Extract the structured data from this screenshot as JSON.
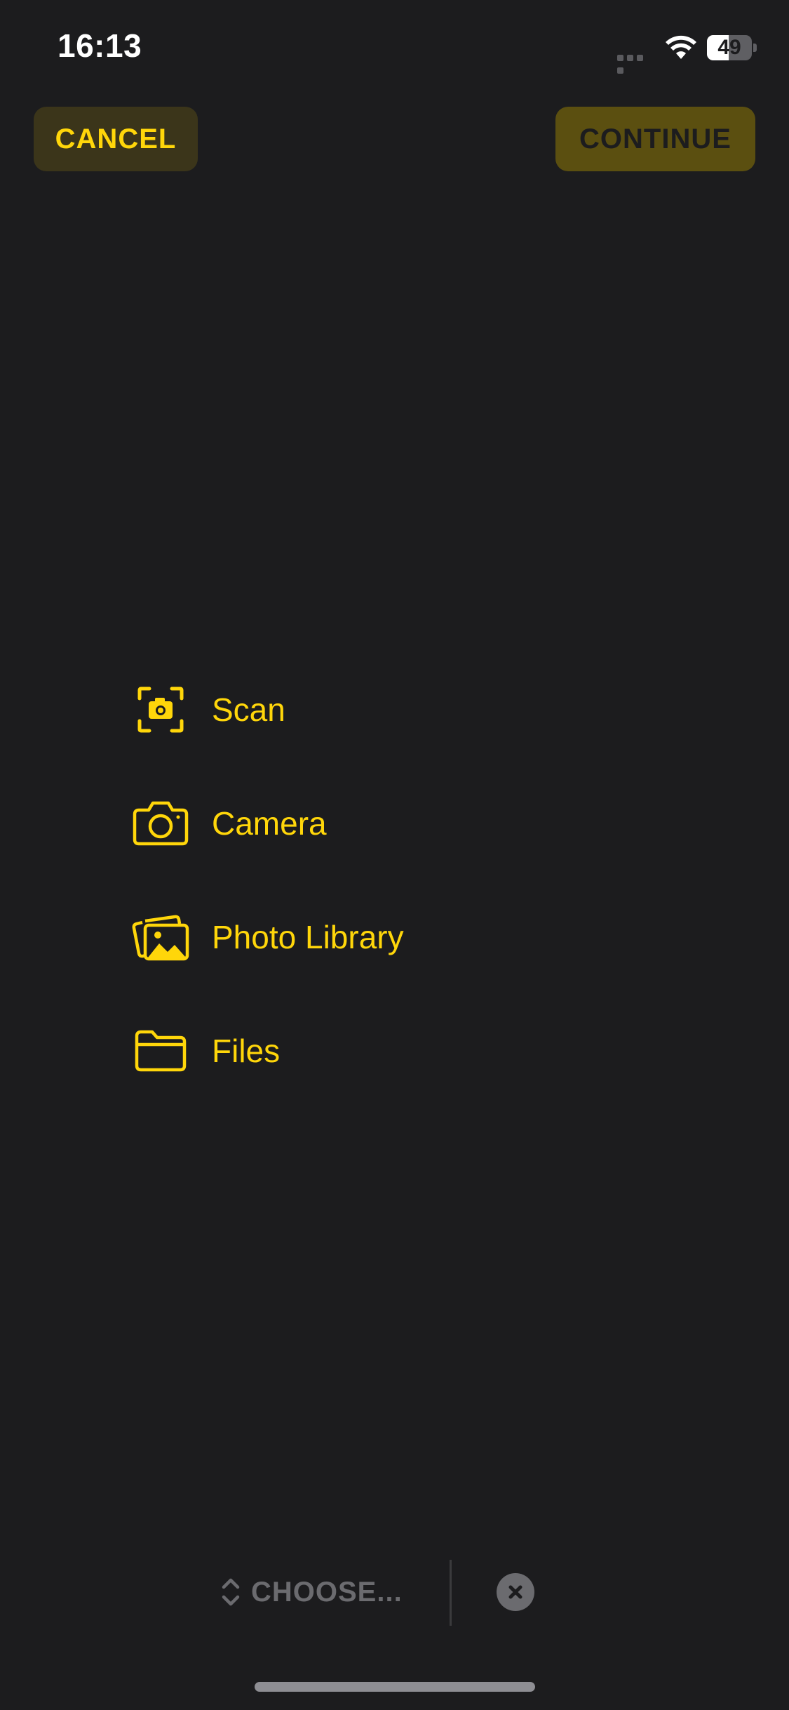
{
  "status_bar": {
    "time": "16:13",
    "battery_level": "49",
    "battery_fraction": 0.49
  },
  "toolbar": {
    "cancel_label": "CANCEL",
    "continue_label": "CONTINUE"
  },
  "menu": {
    "items": [
      {
        "label": "Scan",
        "icon": "scan-icon"
      },
      {
        "label": "Camera",
        "icon": "camera-icon"
      },
      {
        "label": "Photo Library",
        "icon": "photo-library-icon"
      },
      {
        "label": "Files",
        "icon": "folder-icon"
      }
    ]
  },
  "bottom_bar": {
    "choose_label": "CHOOSE..."
  },
  "colors": {
    "background": "#1c1c1e",
    "accent": "#ffd60a",
    "muted": "#6b6b6f"
  }
}
